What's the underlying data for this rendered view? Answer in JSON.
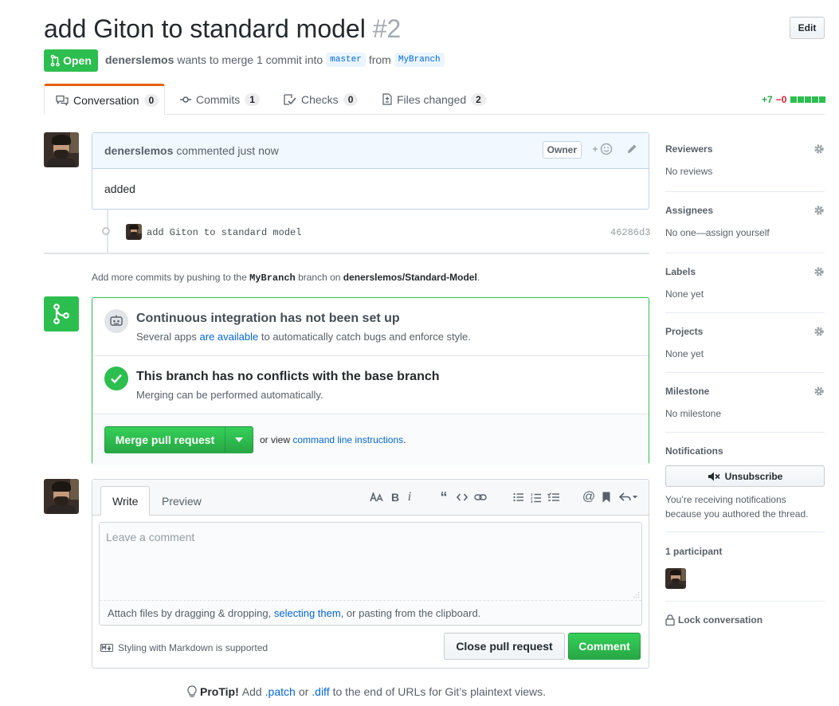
{
  "header": {
    "title": "add Giton to standard model",
    "number": "#2",
    "edit_label": "Edit",
    "state": "Open",
    "author": "denerslemos",
    "merge_text_1": "wants to merge 1 commit into",
    "base_branch": "master",
    "merge_text_2": "from",
    "head_branch": "MyBranch"
  },
  "tabs": [
    {
      "label": "Conversation",
      "count": "0"
    },
    {
      "label": "Commits",
      "count": "1"
    },
    {
      "label": "Checks",
      "count": "0"
    },
    {
      "label": "Files changed",
      "count": "2"
    }
  ],
  "diffstat": {
    "additions": "+7",
    "deletions": "−0",
    "blocks": 5
  },
  "comment": {
    "author": "denerslemos",
    "action": "commented just now",
    "label": "Owner",
    "body": "added"
  },
  "commit": {
    "message": "add Giton to standard model",
    "sha": "46286d3"
  },
  "push_hint": {
    "prefix": "Add more commits by pushing to the",
    "branch": "MyBranch",
    "middle": "branch on",
    "repo": "denerslemos/Standard-Model",
    "suffix": "."
  },
  "merge_box": {
    "ci_title": "Continuous integration has not been set up",
    "ci_sub_prefix": "Several apps",
    "ci_sub_link": "are available",
    "ci_sub_suffix": "to automatically catch bugs and enforce style.",
    "conflict_title": "This branch has no conflicts with the base branch",
    "conflict_sub": "Merging can be performed automatically.",
    "merge_button": "Merge pull request",
    "or_view": "or view",
    "cli_link": "command line instructions",
    "cli_suffix": "."
  },
  "new_comment": {
    "tab_write": "Write",
    "tab_preview": "Preview",
    "placeholder": "Leave a comment",
    "attach_prefix": "Attach files by dragging & dropping,",
    "attach_link": "selecting them",
    "attach_suffix": ", or pasting from the clipboard.",
    "markdown_hint": "Styling with Markdown is supported",
    "close_button": "Close pull request",
    "comment_button": "Comment"
  },
  "protip": {
    "label": "ProTip!",
    "text_1": "Add",
    "link_1": ".patch",
    "text_2": "or",
    "link_2": ".diff",
    "text_3": "to the end of URLs for Git’s plaintext views."
  },
  "sidebar": {
    "reviewers": {
      "heading": "Reviewers",
      "value": "No reviews"
    },
    "assignees": {
      "heading": "Assignees",
      "value": "No one—assign yourself"
    },
    "labels": {
      "heading": "Labels",
      "value": "None yet"
    },
    "projects": {
      "heading": "Projects",
      "value": "None yet"
    },
    "milestone": {
      "heading": "Milestone",
      "value": "No milestone"
    },
    "notifications": {
      "heading": "Notifications",
      "button": "Unsubscribe",
      "reason": "You’re receiving notifications because you authored the thread."
    },
    "participants": {
      "heading": "1 participant"
    },
    "lock": "Lock conversation"
  },
  "colors": {
    "green": "#2cbe4e",
    "link": "#0366d6",
    "accent_tab": "#e36209",
    "deletions": "#cb2431"
  }
}
